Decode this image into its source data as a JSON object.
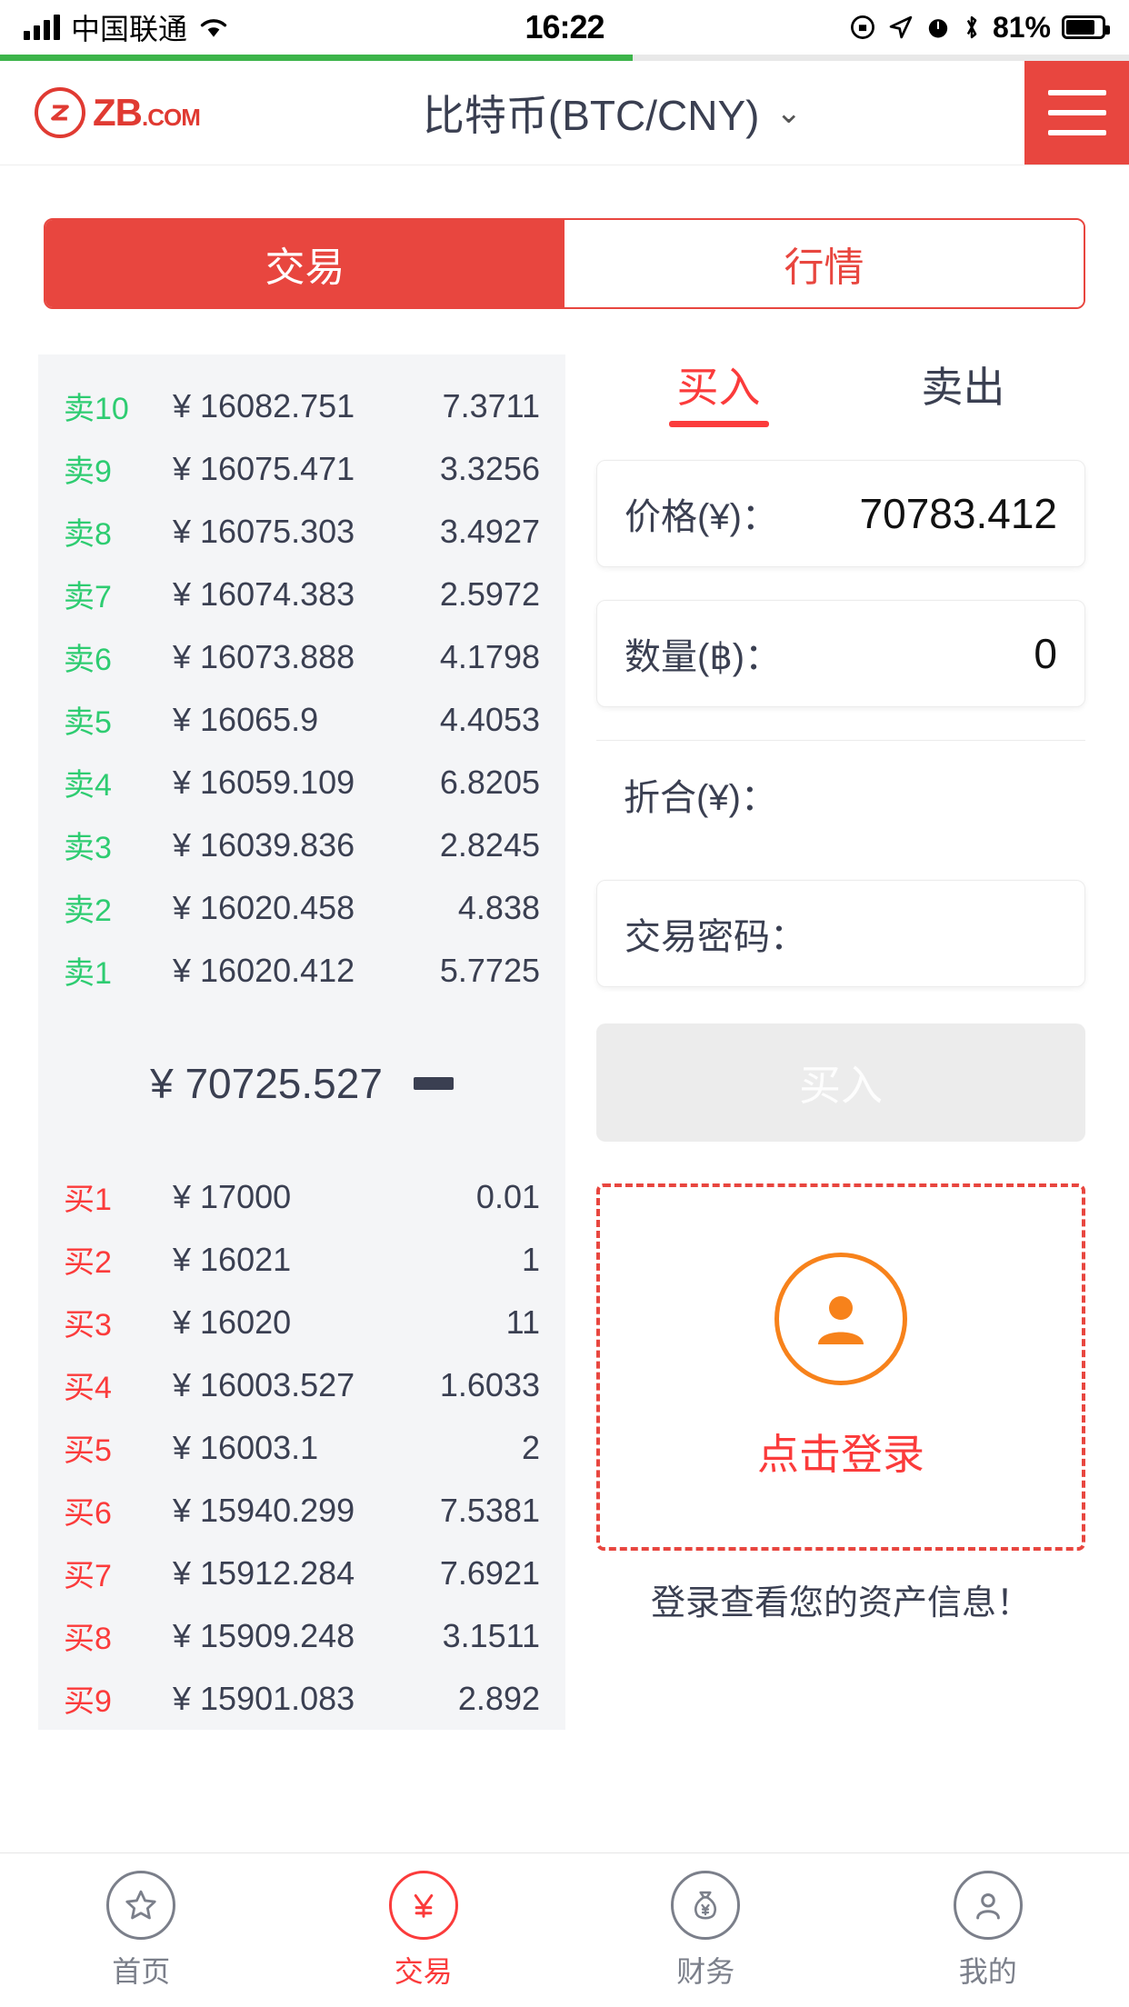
{
  "statusbar": {
    "carrier": "中国联通",
    "time": "16:22",
    "battery": "81%",
    "icons": [
      "signal-icon",
      "wifi-icon",
      "rotation-lock-icon",
      "location-icon",
      "alarm-icon",
      "bluetooth-icon",
      "battery-icon"
    ]
  },
  "header": {
    "logo_mark": "Ⓩ",
    "logo_text": "ZB",
    "logo_suffix": ".COM",
    "pair": "比特币(BTC/CNY)",
    "chevron": "⌄",
    "menu_icon": "hamburger-icon"
  },
  "tabs": [
    {
      "label": "交易",
      "active": true
    },
    {
      "label": "行情",
      "active": false
    }
  ],
  "orderbook": {
    "asks": [
      {
        "tag": "卖10",
        "price": "16082.751",
        "amount": "7.3711"
      },
      {
        "tag": "卖9",
        "price": "16075.471",
        "amount": "3.3256"
      },
      {
        "tag": "卖8",
        "price": "16075.303",
        "amount": "3.4927"
      },
      {
        "tag": "卖7",
        "price": "16074.383",
        "amount": "2.5972"
      },
      {
        "tag": "卖6",
        "price": "16073.888",
        "amount": "4.1798"
      },
      {
        "tag": "卖5",
        "price": "16065.9",
        "amount": "4.4053"
      },
      {
        "tag": "卖4",
        "price": "16059.109",
        "amount": "6.8205"
      },
      {
        "tag": "卖3",
        "price": "16039.836",
        "amount": "2.8245"
      },
      {
        "tag": "卖2",
        "price": "16020.458",
        "amount": "4.838"
      },
      {
        "tag": "卖1",
        "price": "16020.412",
        "amount": "5.7725"
      }
    ],
    "last_price": "70725.527",
    "last_currency": "¥",
    "trend": "flat",
    "bids": [
      {
        "tag": "买1",
        "price": "17000",
        "amount": "0.01"
      },
      {
        "tag": "买2",
        "price": "16021",
        "amount": "1"
      },
      {
        "tag": "买3",
        "price": "16020",
        "amount": "11"
      },
      {
        "tag": "买4",
        "price": "16003.527",
        "amount": "1.6033"
      },
      {
        "tag": "买5",
        "price": "16003.1",
        "amount": "2"
      },
      {
        "tag": "买6",
        "price": "15940.299",
        "amount": "7.5381"
      },
      {
        "tag": "买7",
        "price": "15912.284",
        "amount": "7.6921"
      },
      {
        "tag": "买8",
        "price": "15909.248",
        "amount": "3.1511"
      },
      {
        "tag": "买9",
        "price": "15901.083",
        "amount": "2.892"
      }
    ],
    "currency_symbol": "¥"
  },
  "trade": {
    "tabs": [
      {
        "label": "买入",
        "active": true
      },
      {
        "label": "卖出",
        "active": false
      }
    ],
    "fields": [
      {
        "label": "价格(¥)：",
        "value": "70783.412"
      },
      {
        "label": "数量(฿)：",
        "value": "0"
      },
      {
        "label": "折合(¥)：",
        "value": ""
      },
      {
        "label": "交易密码：",
        "value": ""
      }
    ],
    "submit_label": "买入",
    "login": {
      "avatar_icon": "user-avatar-icon",
      "title": "点击登录",
      "subtitle": "登录查看您的资产信息！"
    }
  },
  "bottomnav": [
    {
      "label": "首页",
      "icon": "star-icon",
      "glyph": "☆",
      "active": false
    },
    {
      "label": "交易",
      "icon": "yen-icon",
      "glyph": "¥",
      "active": true
    },
    {
      "label": "财务",
      "icon": "moneybag-icon",
      "glyph": "¥",
      "active": false
    },
    {
      "label": "我的",
      "icon": "person-icon",
      "glyph": "👤",
      "active": false
    }
  ],
  "colors": {
    "brand_red": "#e8463f",
    "sell_green": "#2ecc71",
    "buy_red": "#fb3b3b",
    "progress_green": "#3cb44a",
    "accent_orange": "#f7821b"
  }
}
